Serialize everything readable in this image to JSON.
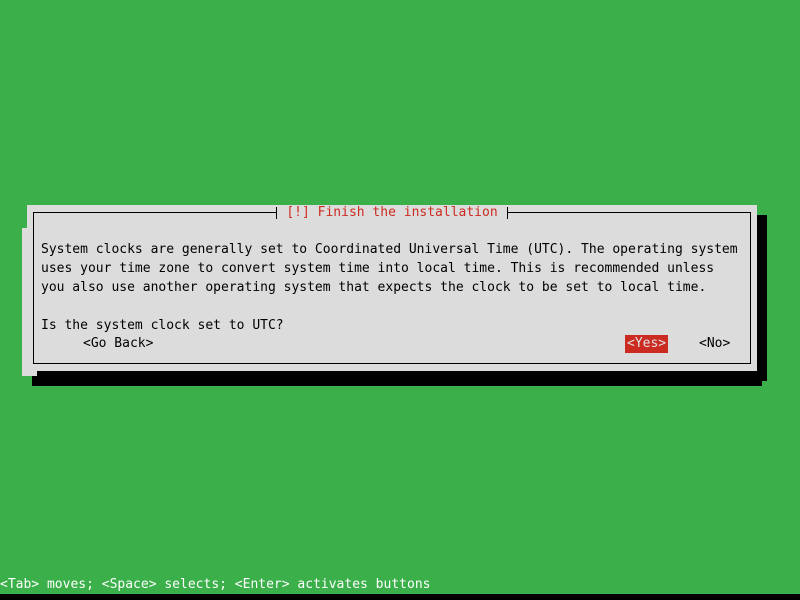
{
  "screen": {
    "background_color": "#3bb04a",
    "panel_color": "#dcdcdc",
    "accent_color": "#cc2b22",
    "shadow_color": "#000000",
    "text_color": "#000000"
  },
  "background_dialog": {
    "present": true,
    "description": "previous dialog partially hidden behind the active one"
  },
  "dialog": {
    "title": "[!] Finish the installation",
    "paragraph_lines": [
      "System clocks are generally set to Coordinated Universal Time (UTC). The operating system",
      "uses your time zone to convert system time into local time. This is recommended unless",
      "you also use another operating system that expects the clock to be set to local time."
    ],
    "question": "Is the system clock set to UTC?",
    "buttons": {
      "go_back": "<Go Back>",
      "yes": "<Yes>",
      "no": "<No>"
    },
    "selected_button": "<Yes>"
  },
  "statusbar": {
    "hint": "<Tab> moves; <Space> selects; <Enter> activates buttons"
  }
}
